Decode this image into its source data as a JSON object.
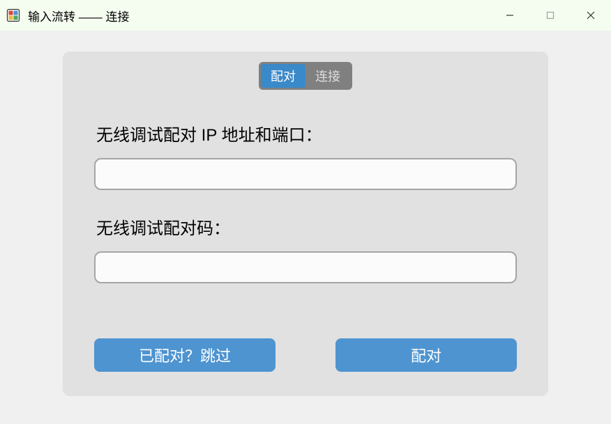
{
  "titlebar": {
    "title": "输入流转 —— 连接"
  },
  "tabs": {
    "pair": "配对",
    "connect": "连接"
  },
  "form": {
    "ip_label": "无线调试配对 IP 地址和端口：",
    "ip_value": "",
    "code_label": "无线调试配对码：",
    "code_value": ""
  },
  "buttons": {
    "skip": "已配对？跳过",
    "pair": "配对"
  }
}
